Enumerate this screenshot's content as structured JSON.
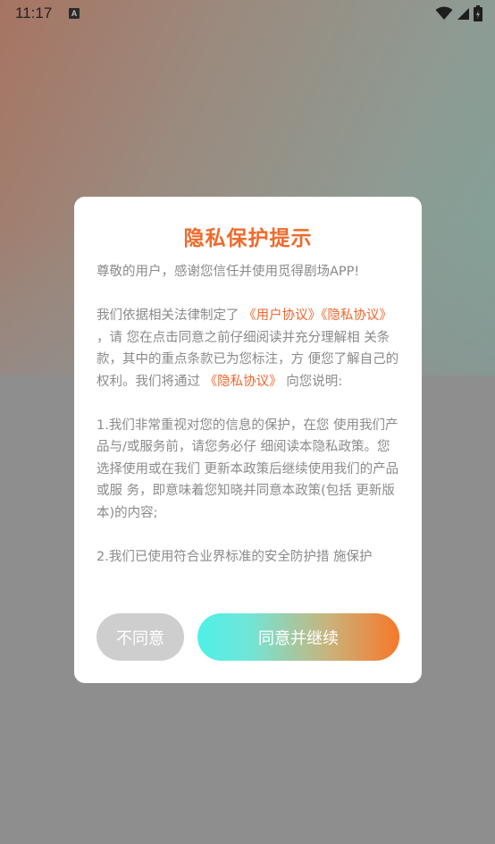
{
  "status_bar": {
    "time": "11:17",
    "notification_badge": "A",
    "icons": [
      "wifi-icon",
      "cell-signal-icon",
      "battery-icon"
    ]
  },
  "dialog": {
    "title": "隐私保护提示",
    "greeting": "尊敬的用户，感谢您信任并使用觅得剧场APP!",
    "para1": {
      "prefix": "我们依据相关法律制定了 ",
      "link_user_agreement": "《用户协议》",
      "link_privacy": "《隐私协议》",
      "middle": " ，请 您在点击同意之前仔细阅读并充分理解相 关条款，其中的重点条款已为您标注，方 便您了解自己的权利。我们将通过 ",
      "link_privacy_2": "《隐私协议》",
      "suffix": " 向您说明:"
    },
    "item1": "1.我们非常重视对您的信息的保护，在您 使用我们产品与/或服务前，请您务必仔 细阅读本隐私政策。您选择使用或在我们 更新本政策后继续使用我们的产品或服 务，即意味着您知晓并同意本政策(包括 更新版本)的内容;",
    "item2": "2.我们已使用符合业界标准的安全防护措 施保护",
    "disagree_label": "不同意",
    "agree_label": "同意并继续"
  },
  "colors": {
    "accent": "#f06a2a",
    "link": "#f0662e",
    "body_text": "#8a8a8a",
    "disagree_bg": "#cecece",
    "agree_gradient_start": "#4ff0e8",
    "agree_gradient_end": "#f6782a"
  }
}
